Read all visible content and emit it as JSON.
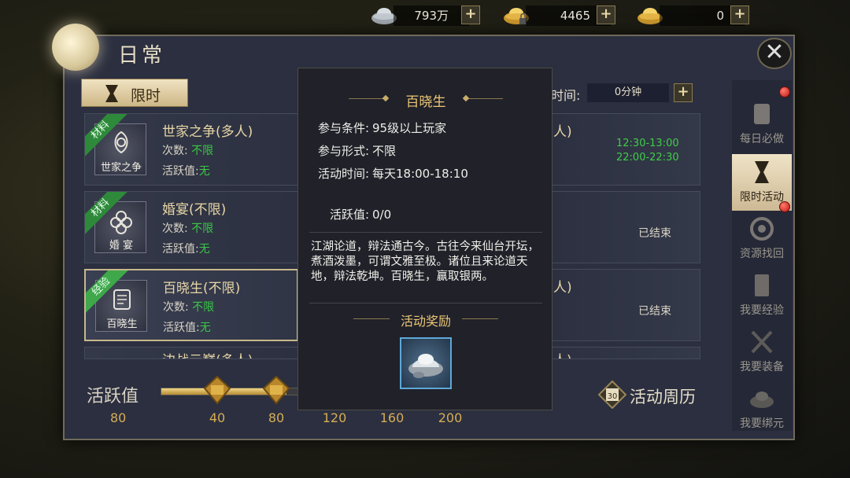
{
  "resources": [
    {
      "icon": "silver-ingot-icon",
      "value": "793万"
    },
    {
      "icon": "locked-gold-ingot-icon",
      "value": "4465"
    },
    {
      "icon": "gold-ingot-icon",
      "value": "0"
    }
  ],
  "header": {
    "title": "日常",
    "close_icon": "close-icon"
  },
  "tab": {
    "label": "限时"
  },
  "time": {
    "label": "时间:",
    "value": "0分钟"
  },
  "rows": [
    {
      "tag": "材料",
      "tag_color": "#2e8a3a",
      "icon_caption": "世家之争",
      "name": "世家之争(多人)",
      "count_label": "次数:",
      "count_value": "不限",
      "activity_label": "活跃值:",
      "activity_value": "无",
      "right_paren": "人)",
      "time1": "12:30-13:00",
      "time2": "22:00-22:30"
    },
    {
      "tag": "材料",
      "tag_color": "#2e8a3a",
      "icon_caption": "婚 宴",
      "name": "婚宴(不限)",
      "count_label": "次数:",
      "count_value": "不限",
      "activity_label": "活跃值:",
      "activity_value": "无",
      "status": "已结束"
    },
    {
      "tag": "经验",
      "tag_color": "#3ea84a",
      "icon_caption": "百晓生",
      "name": "百晓生(不限)",
      "count_label": "次数:",
      "count_value": "不限",
      "activity_label": "活跃值:",
      "activity_value": "无",
      "right_paren": "人)",
      "status": "已结束"
    },
    {
      "name": "边战云巅(多人)",
      "right_paren": "人)"
    }
  ],
  "sidebar": [
    {
      "label": "每日必做",
      "icon": "scroll-icon"
    },
    {
      "label": "限时活动",
      "icon": "hourglass-icon"
    },
    {
      "label": "资源找回",
      "icon": "swirl-icon"
    },
    {
      "label": "我要经验",
      "icon": "book-icon"
    },
    {
      "label": "我要装备",
      "icon": "crossed-swords-icon"
    },
    {
      "label": "我要绑元",
      "icon": "ingot-icon"
    }
  ],
  "activity": {
    "label": "活跃值",
    "current": "80",
    "progress": 0.4,
    "milestones": [
      "40",
      "80",
      "120",
      "160",
      "200"
    ]
  },
  "calendar": {
    "label": "活动周历",
    "day": "30"
  },
  "tooltip": {
    "title": "百晓生",
    "condition_label": "参与条件:",
    "condition": "95级以上玩家",
    "form_label": "参与形式:",
    "form": "不限",
    "time_label": "活动时间:",
    "time": "每天18:00-18:10",
    "activity_label": "活跃值:",
    "activity": "0/0",
    "desc": "江湖论道，辩法通古今。古往今来仙台开坛，煮酒泼墨，可谓文雅至极。诸位且来论道天地，辩法乾坤。百晓生，赢取银两。",
    "reward_title": "活动奖励",
    "reward_icon": "silver-ingot-icon"
  }
}
